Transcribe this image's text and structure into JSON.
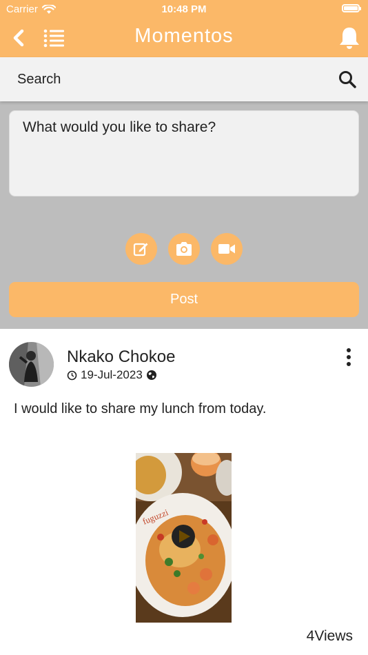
{
  "status_bar": {
    "carrier": "Carrier",
    "time": "10:48 PM"
  },
  "header": {
    "title": "Momentos",
    "notification_count": "0"
  },
  "search": {
    "placeholder": "Search"
  },
  "composer": {
    "placeholder": "What would you like to share?",
    "post_label": "Post"
  },
  "post": {
    "author": "Nkako Chokoe",
    "date": "19-Jul-2023",
    "text": "I would like to share my lunch from today.",
    "views": "4Views"
  },
  "colors": {
    "accent": "#fbb868",
    "badge": "#ff1200",
    "composer_bg": "#bdbdbd"
  }
}
